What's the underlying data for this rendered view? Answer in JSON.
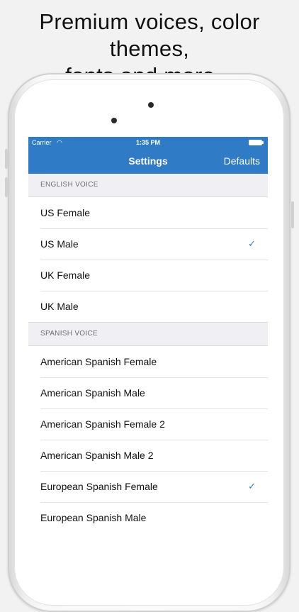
{
  "promo": {
    "line1": "Premium voices, color themes,",
    "line2": "fonts and more..."
  },
  "status_bar": {
    "carrier": "Carrier",
    "time": "1:35 PM",
    "wifi_icon": "◠"
  },
  "nav": {
    "title": "Settings",
    "action": "Defaults"
  },
  "sections": {
    "english": {
      "header": "ENGLISH VOICE",
      "items": [
        {
          "label": "US Female",
          "checked": false
        },
        {
          "label": "US Male",
          "checked": true
        },
        {
          "label": "UK Female",
          "checked": false
        },
        {
          "label": "UK Male",
          "checked": false
        }
      ]
    },
    "spanish": {
      "header": "SPANISH VOICE",
      "items": [
        {
          "label": "American Spanish Female",
          "checked": false
        },
        {
          "label": "American Spanish Male",
          "checked": false
        },
        {
          "label": "American Spanish Female 2",
          "checked": false
        },
        {
          "label": "American Spanish Male 2",
          "checked": false
        },
        {
          "label": "European Spanish Female",
          "checked": true
        },
        {
          "label": "European Spanish Male",
          "checked": false
        }
      ]
    }
  },
  "icons": {
    "check": "✓"
  },
  "colors": {
    "accent": "#2f7bc6",
    "background": "#efeff4",
    "text": "#111111"
  }
}
